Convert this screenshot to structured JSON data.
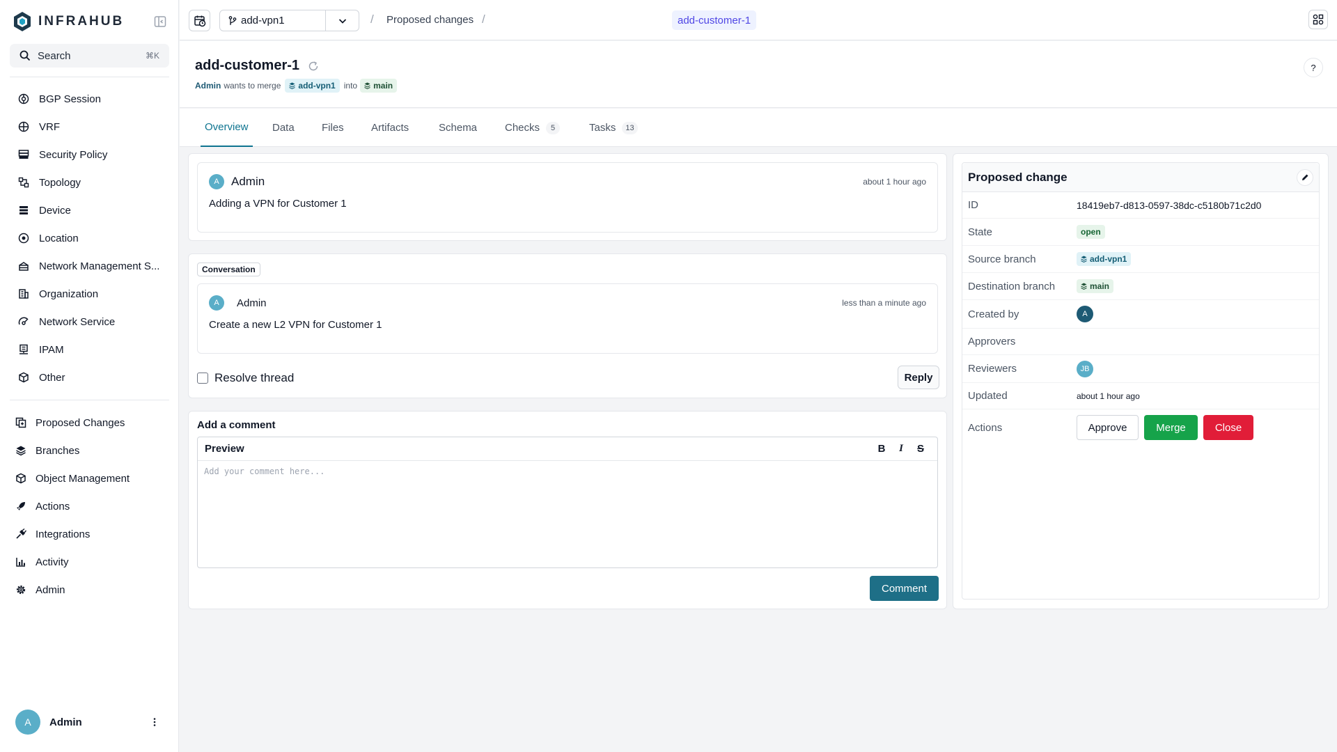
{
  "app": {
    "name": "INFRAHUB"
  },
  "search": {
    "label": "Search",
    "shortcut": "⌘K"
  },
  "sidebar": {
    "schema_items": [
      {
        "label": "BGP Session",
        "icon": "bgp-icon"
      },
      {
        "label": "VRF",
        "icon": "vrf-icon"
      },
      {
        "label": "Security Policy",
        "icon": "security-policy-icon"
      },
      {
        "label": "Topology",
        "icon": "topology-icon"
      },
      {
        "label": "Device",
        "icon": "device-icon"
      },
      {
        "label": "Location",
        "icon": "location-pin-icon"
      },
      {
        "label": "Network Management S...",
        "icon": "network-management-icon"
      },
      {
        "label": "Organization",
        "icon": "organization-icon"
      },
      {
        "label": "Network Service",
        "icon": "network-service-icon"
      },
      {
        "label": "IPAM",
        "icon": "ipam-icon"
      },
      {
        "label": "Other",
        "icon": "other-icon"
      }
    ],
    "app_items": [
      {
        "label": "Proposed Changes",
        "icon": "proposed-changes-icon"
      },
      {
        "label": "Branches",
        "icon": "branches-icon"
      },
      {
        "label": "Object Management",
        "icon": "object-management-icon"
      },
      {
        "label": "Actions",
        "icon": "actions-icon"
      },
      {
        "label": "Integrations",
        "icon": "integrations-icon"
      },
      {
        "label": "Activity",
        "icon": "activity-icon"
      },
      {
        "label": "Admin",
        "icon": "admin-gear-icon"
      }
    ],
    "user": {
      "initial": "A",
      "name": "Admin"
    }
  },
  "topbar": {
    "branch": "add-vpn1",
    "breadcrumb": {
      "sep": "/",
      "parent": "Proposed changes",
      "current": "add-customer-1"
    }
  },
  "header": {
    "title": "add-customer-1",
    "author": "Admin",
    "wants_to_merge": "wants to merge",
    "source_branch": "add-vpn1",
    "into": "into",
    "destination_branch": "main",
    "help": "?"
  },
  "tabs": [
    {
      "label": "Overview",
      "count": null
    },
    {
      "label": "Data",
      "count": null
    },
    {
      "label": "Files",
      "count": null
    },
    {
      "label": "Artifacts",
      "count": null
    },
    {
      "label": "Schema",
      "count": null
    },
    {
      "label": "Checks",
      "count": "5"
    },
    {
      "label": "Tasks",
      "count": "13"
    }
  ],
  "description": {
    "initial": "A",
    "author": "Admin",
    "time": "about 1 hour ago",
    "text": "Adding a VPN for Customer 1"
  },
  "conversation": {
    "label": "Conversation",
    "initial": "A",
    "author": "Admin",
    "time": "less than a minute ago",
    "text": "Create a new L2 VPN for Customer 1",
    "resolve_label": "Resolve thread",
    "reply_label": "Reply"
  },
  "comment": {
    "label": "Add a comment",
    "preview_label": "Preview",
    "bold": "B",
    "italic": "I",
    "strike": "S",
    "placeholder": "Add your comment here...",
    "button": "Comment"
  },
  "details": {
    "title": "Proposed change",
    "id_label": "ID",
    "id": "18419eb7-d813-0597-38dc-c5180b71c2d0",
    "state_label": "State",
    "state": "open",
    "source_label": "Source branch",
    "source": "add-vpn1",
    "destination_label": "Destination branch",
    "destination": "main",
    "created_by_label": "Created by",
    "created_by_initial": "A",
    "approvers_label": "Approvers",
    "reviewers_label": "Reviewers",
    "reviewer_initials": "JB",
    "updated_label": "Updated",
    "updated": "about 1 hour ago",
    "actions_label": "Actions",
    "approve": "Approve",
    "merge": "Merge",
    "close": "Close"
  },
  "colors": {
    "accent": "#0e7490",
    "merge": "#16a34a",
    "close": "#e11d38",
    "comment_button": "#1e6f87",
    "avatar": "#5aaec8",
    "avatar_dark": "#1e5a74"
  }
}
